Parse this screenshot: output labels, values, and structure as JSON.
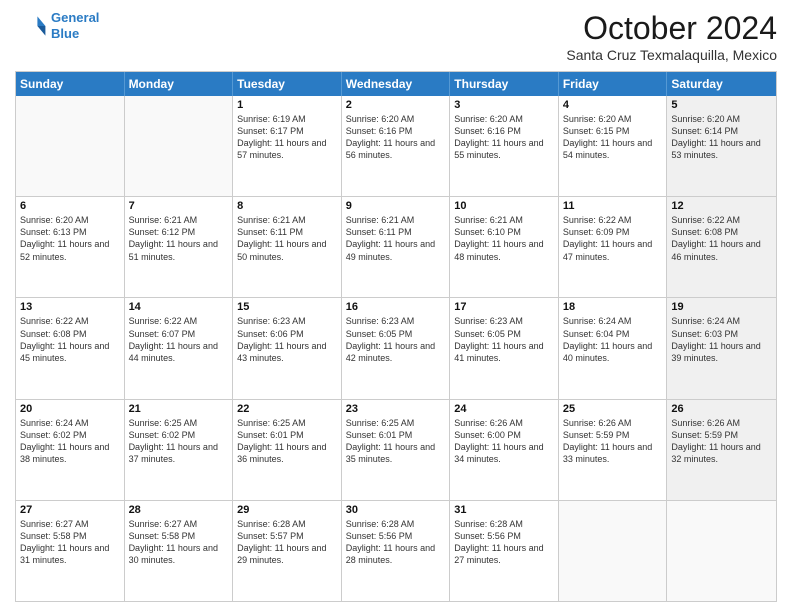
{
  "logo": {
    "line1": "General",
    "line2": "Blue"
  },
  "title": "October 2024",
  "location": "Santa Cruz Texmalaquilla, Mexico",
  "header_days": [
    "Sunday",
    "Monday",
    "Tuesday",
    "Wednesday",
    "Thursday",
    "Friday",
    "Saturday"
  ],
  "weeks": [
    [
      {
        "day": "",
        "sunrise": "",
        "sunset": "",
        "daylight": "",
        "shaded": true
      },
      {
        "day": "",
        "sunrise": "",
        "sunset": "",
        "daylight": "",
        "shaded": true
      },
      {
        "day": "1",
        "sunrise": "Sunrise: 6:19 AM",
        "sunset": "Sunset: 6:17 PM",
        "daylight": "Daylight: 11 hours and 57 minutes.",
        "shaded": false
      },
      {
        "day": "2",
        "sunrise": "Sunrise: 6:20 AM",
        "sunset": "Sunset: 6:16 PM",
        "daylight": "Daylight: 11 hours and 56 minutes.",
        "shaded": false
      },
      {
        "day": "3",
        "sunrise": "Sunrise: 6:20 AM",
        "sunset": "Sunset: 6:16 PM",
        "daylight": "Daylight: 11 hours and 55 minutes.",
        "shaded": false
      },
      {
        "day": "4",
        "sunrise": "Sunrise: 6:20 AM",
        "sunset": "Sunset: 6:15 PM",
        "daylight": "Daylight: 11 hours and 54 minutes.",
        "shaded": false
      },
      {
        "day": "5",
        "sunrise": "Sunrise: 6:20 AM",
        "sunset": "Sunset: 6:14 PM",
        "daylight": "Daylight: 11 hours and 53 minutes.",
        "shaded": true
      }
    ],
    [
      {
        "day": "6",
        "sunrise": "Sunrise: 6:20 AM",
        "sunset": "Sunset: 6:13 PM",
        "daylight": "Daylight: 11 hours and 52 minutes.",
        "shaded": false
      },
      {
        "day": "7",
        "sunrise": "Sunrise: 6:21 AM",
        "sunset": "Sunset: 6:12 PM",
        "daylight": "Daylight: 11 hours and 51 minutes.",
        "shaded": false
      },
      {
        "day": "8",
        "sunrise": "Sunrise: 6:21 AM",
        "sunset": "Sunset: 6:11 PM",
        "daylight": "Daylight: 11 hours and 50 minutes.",
        "shaded": false
      },
      {
        "day": "9",
        "sunrise": "Sunrise: 6:21 AM",
        "sunset": "Sunset: 6:11 PM",
        "daylight": "Daylight: 11 hours and 49 minutes.",
        "shaded": false
      },
      {
        "day": "10",
        "sunrise": "Sunrise: 6:21 AM",
        "sunset": "Sunset: 6:10 PM",
        "daylight": "Daylight: 11 hours and 48 minutes.",
        "shaded": false
      },
      {
        "day": "11",
        "sunrise": "Sunrise: 6:22 AM",
        "sunset": "Sunset: 6:09 PM",
        "daylight": "Daylight: 11 hours and 47 minutes.",
        "shaded": false
      },
      {
        "day": "12",
        "sunrise": "Sunrise: 6:22 AM",
        "sunset": "Sunset: 6:08 PM",
        "daylight": "Daylight: 11 hours and 46 minutes.",
        "shaded": true
      }
    ],
    [
      {
        "day": "13",
        "sunrise": "Sunrise: 6:22 AM",
        "sunset": "Sunset: 6:08 PM",
        "daylight": "Daylight: 11 hours and 45 minutes.",
        "shaded": false
      },
      {
        "day": "14",
        "sunrise": "Sunrise: 6:22 AM",
        "sunset": "Sunset: 6:07 PM",
        "daylight": "Daylight: 11 hours and 44 minutes.",
        "shaded": false
      },
      {
        "day": "15",
        "sunrise": "Sunrise: 6:23 AM",
        "sunset": "Sunset: 6:06 PM",
        "daylight": "Daylight: 11 hours and 43 minutes.",
        "shaded": false
      },
      {
        "day": "16",
        "sunrise": "Sunrise: 6:23 AM",
        "sunset": "Sunset: 6:05 PM",
        "daylight": "Daylight: 11 hours and 42 minutes.",
        "shaded": false
      },
      {
        "day": "17",
        "sunrise": "Sunrise: 6:23 AM",
        "sunset": "Sunset: 6:05 PM",
        "daylight": "Daylight: 11 hours and 41 minutes.",
        "shaded": false
      },
      {
        "day": "18",
        "sunrise": "Sunrise: 6:24 AM",
        "sunset": "Sunset: 6:04 PM",
        "daylight": "Daylight: 11 hours and 40 minutes.",
        "shaded": false
      },
      {
        "day": "19",
        "sunrise": "Sunrise: 6:24 AM",
        "sunset": "Sunset: 6:03 PM",
        "daylight": "Daylight: 11 hours and 39 minutes.",
        "shaded": true
      }
    ],
    [
      {
        "day": "20",
        "sunrise": "Sunrise: 6:24 AM",
        "sunset": "Sunset: 6:02 PM",
        "daylight": "Daylight: 11 hours and 38 minutes.",
        "shaded": false
      },
      {
        "day": "21",
        "sunrise": "Sunrise: 6:25 AM",
        "sunset": "Sunset: 6:02 PM",
        "daylight": "Daylight: 11 hours and 37 minutes.",
        "shaded": false
      },
      {
        "day": "22",
        "sunrise": "Sunrise: 6:25 AM",
        "sunset": "Sunset: 6:01 PM",
        "daylight": "Daylight: 11 hours and 36 minutes.",
        "shaded": false
      },
      {
        "day": "23",
        "sunrise": "Sunrise: 6:25 AM",
        "sunset": "Sunset: 6:01 PM",
        "daylight": "Daylight: 11 hours and 35 minutes.",
        "shaded": false
      },
      {
        "day": "24",
        "sunrise": "Sunrise: 6:26 AM",
        "sunset": "Sunset: 6:00 PM",
        "daylight": "Daylight: 11 hours and 34 minutes.",
        "shaded": false
      },
      {
        "day": "25",
        "sunrise": "Sunrise: 6:26 AM",
        "sunset": "Sunset: 5:59 PM",
        "daylight": "Daylight: 11 hours and 33 minutes.",
        "shaded": false
      },
      {
        "day": "26",
        "sunrise": "Sunrise: 6:26 AM",
        "sunset": "Sunset: 5:59 PM",
        "daylight": "Daylight: 11 hours and 32 minutes.",
        "shaded": true
      }
    ],
    [
      {
        "day": "27",
        "sunrise": "Sunrise: 6:27 AM",
        "sunset": "Sunset: 5:58 PM",
        "daylight": "Daylight: 11 hours and 31 minutes.",
        "shaded": false
      },
      {
        "day": "28",
        "sunrise": "Sunrise: 6:27 AM",
        "sunset": "Sunset: 5:58 PM",
        "daylight": "Daylight: 11 hours and 30 minutes.",
        "shaded": false
      },
      {
        "day": "29",
        "sunrise": "Sunrise: 6:28 AM",
        "sunset": "Sunset: 5:57 PM",
        "daylight": "Daylight: 11 hours and 29 minutes.",
        "shaded": false
      },
      {
        "day": "30",
        "sunrise": "Sunrise: 6:28 AM",
        "sunset": "Sunset: 5:56 PM",
        "daylight": "Daylight: 11 hours and 28 minutes.",
        "shaded": false
      },
      {
        "day": "31",
        "sunrise": "Sunrise: 6:28 AM",
        "sunset": "Sunset: 5:56 PM",
        "daylight": "Daylight: 11 hours and 27 minutes.",
        "shaded": false
      },
      {
        "day": "",
        "sunrise": "",
        "sunset": "",
        "daylight": "",
        "shaded": true
      },
      {
        "day": "",
        "sunrise": "",
        "sunset": "",
        "daylight": "",
        "shaded": true
      }
    ]
  ]
}
